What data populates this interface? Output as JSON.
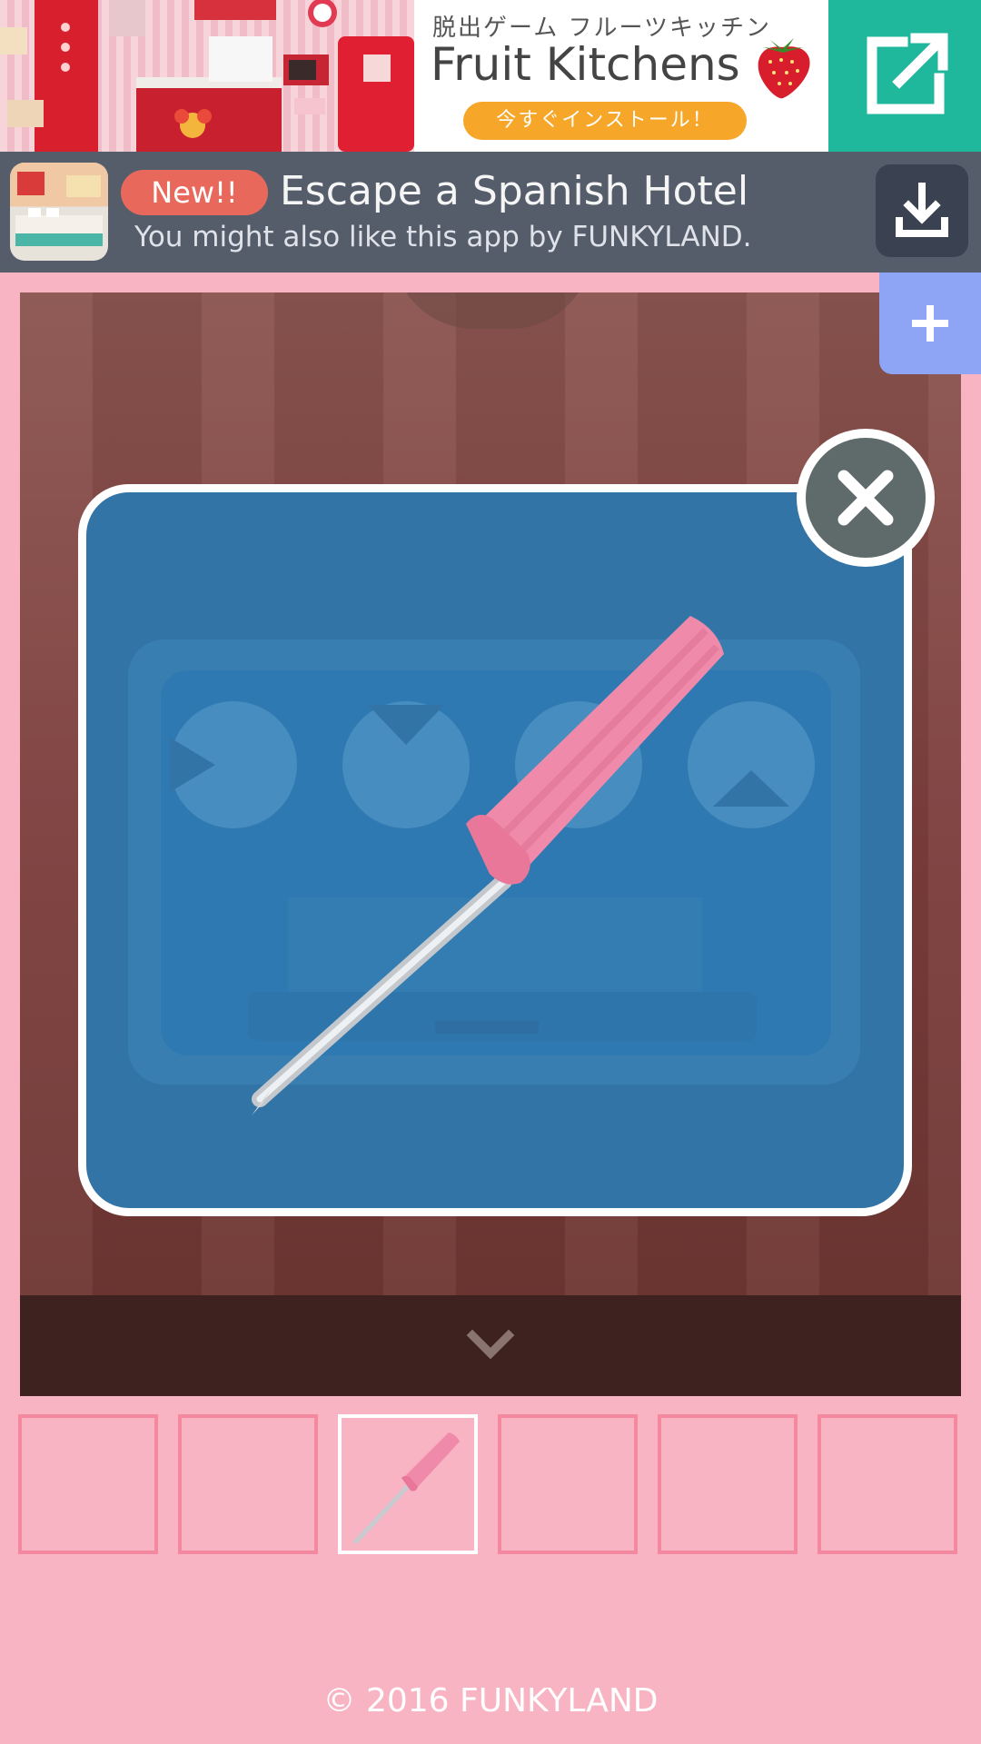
{
  "top_ad": {
    "jp_title": "脱出ゲーム フルーツキッチン",
    "title": "Fruit Kitchens",
    "install_label": "今すぐインストール！",
    "open_icon": "external-link-icon",
    "accent_color": "#1fb89c"
  },
  "promo": {
    "badge": "New!!",
    "title": "Escape a Spanish Hotel",
    "subtitle": "You might also like this app by FUNKYLAND.",
    "download_icon": "download-icon"
  },
  "side_tab": {
    "icon": "plus-icon"
  },
  "modal": {
    "item": "screwdriver",
    "close_icon": "close-icon"
  },
  "scene": {
    "expand_icon": "chevron-down-icon"
  },
  "inventory": {
    "slots": [
      {
        "item": ""
      },
      {
        "item": ""
      },
      {
        "item": "screwdriver",
        "selected": true
      },
      {
        "item": ""
      },
      {
        "item": ""
      },
      {
        "item": ""
      }
    ]
  },
  "footer": {
    "copyright": "© 2016 FUNKYLAND"
  }
}
